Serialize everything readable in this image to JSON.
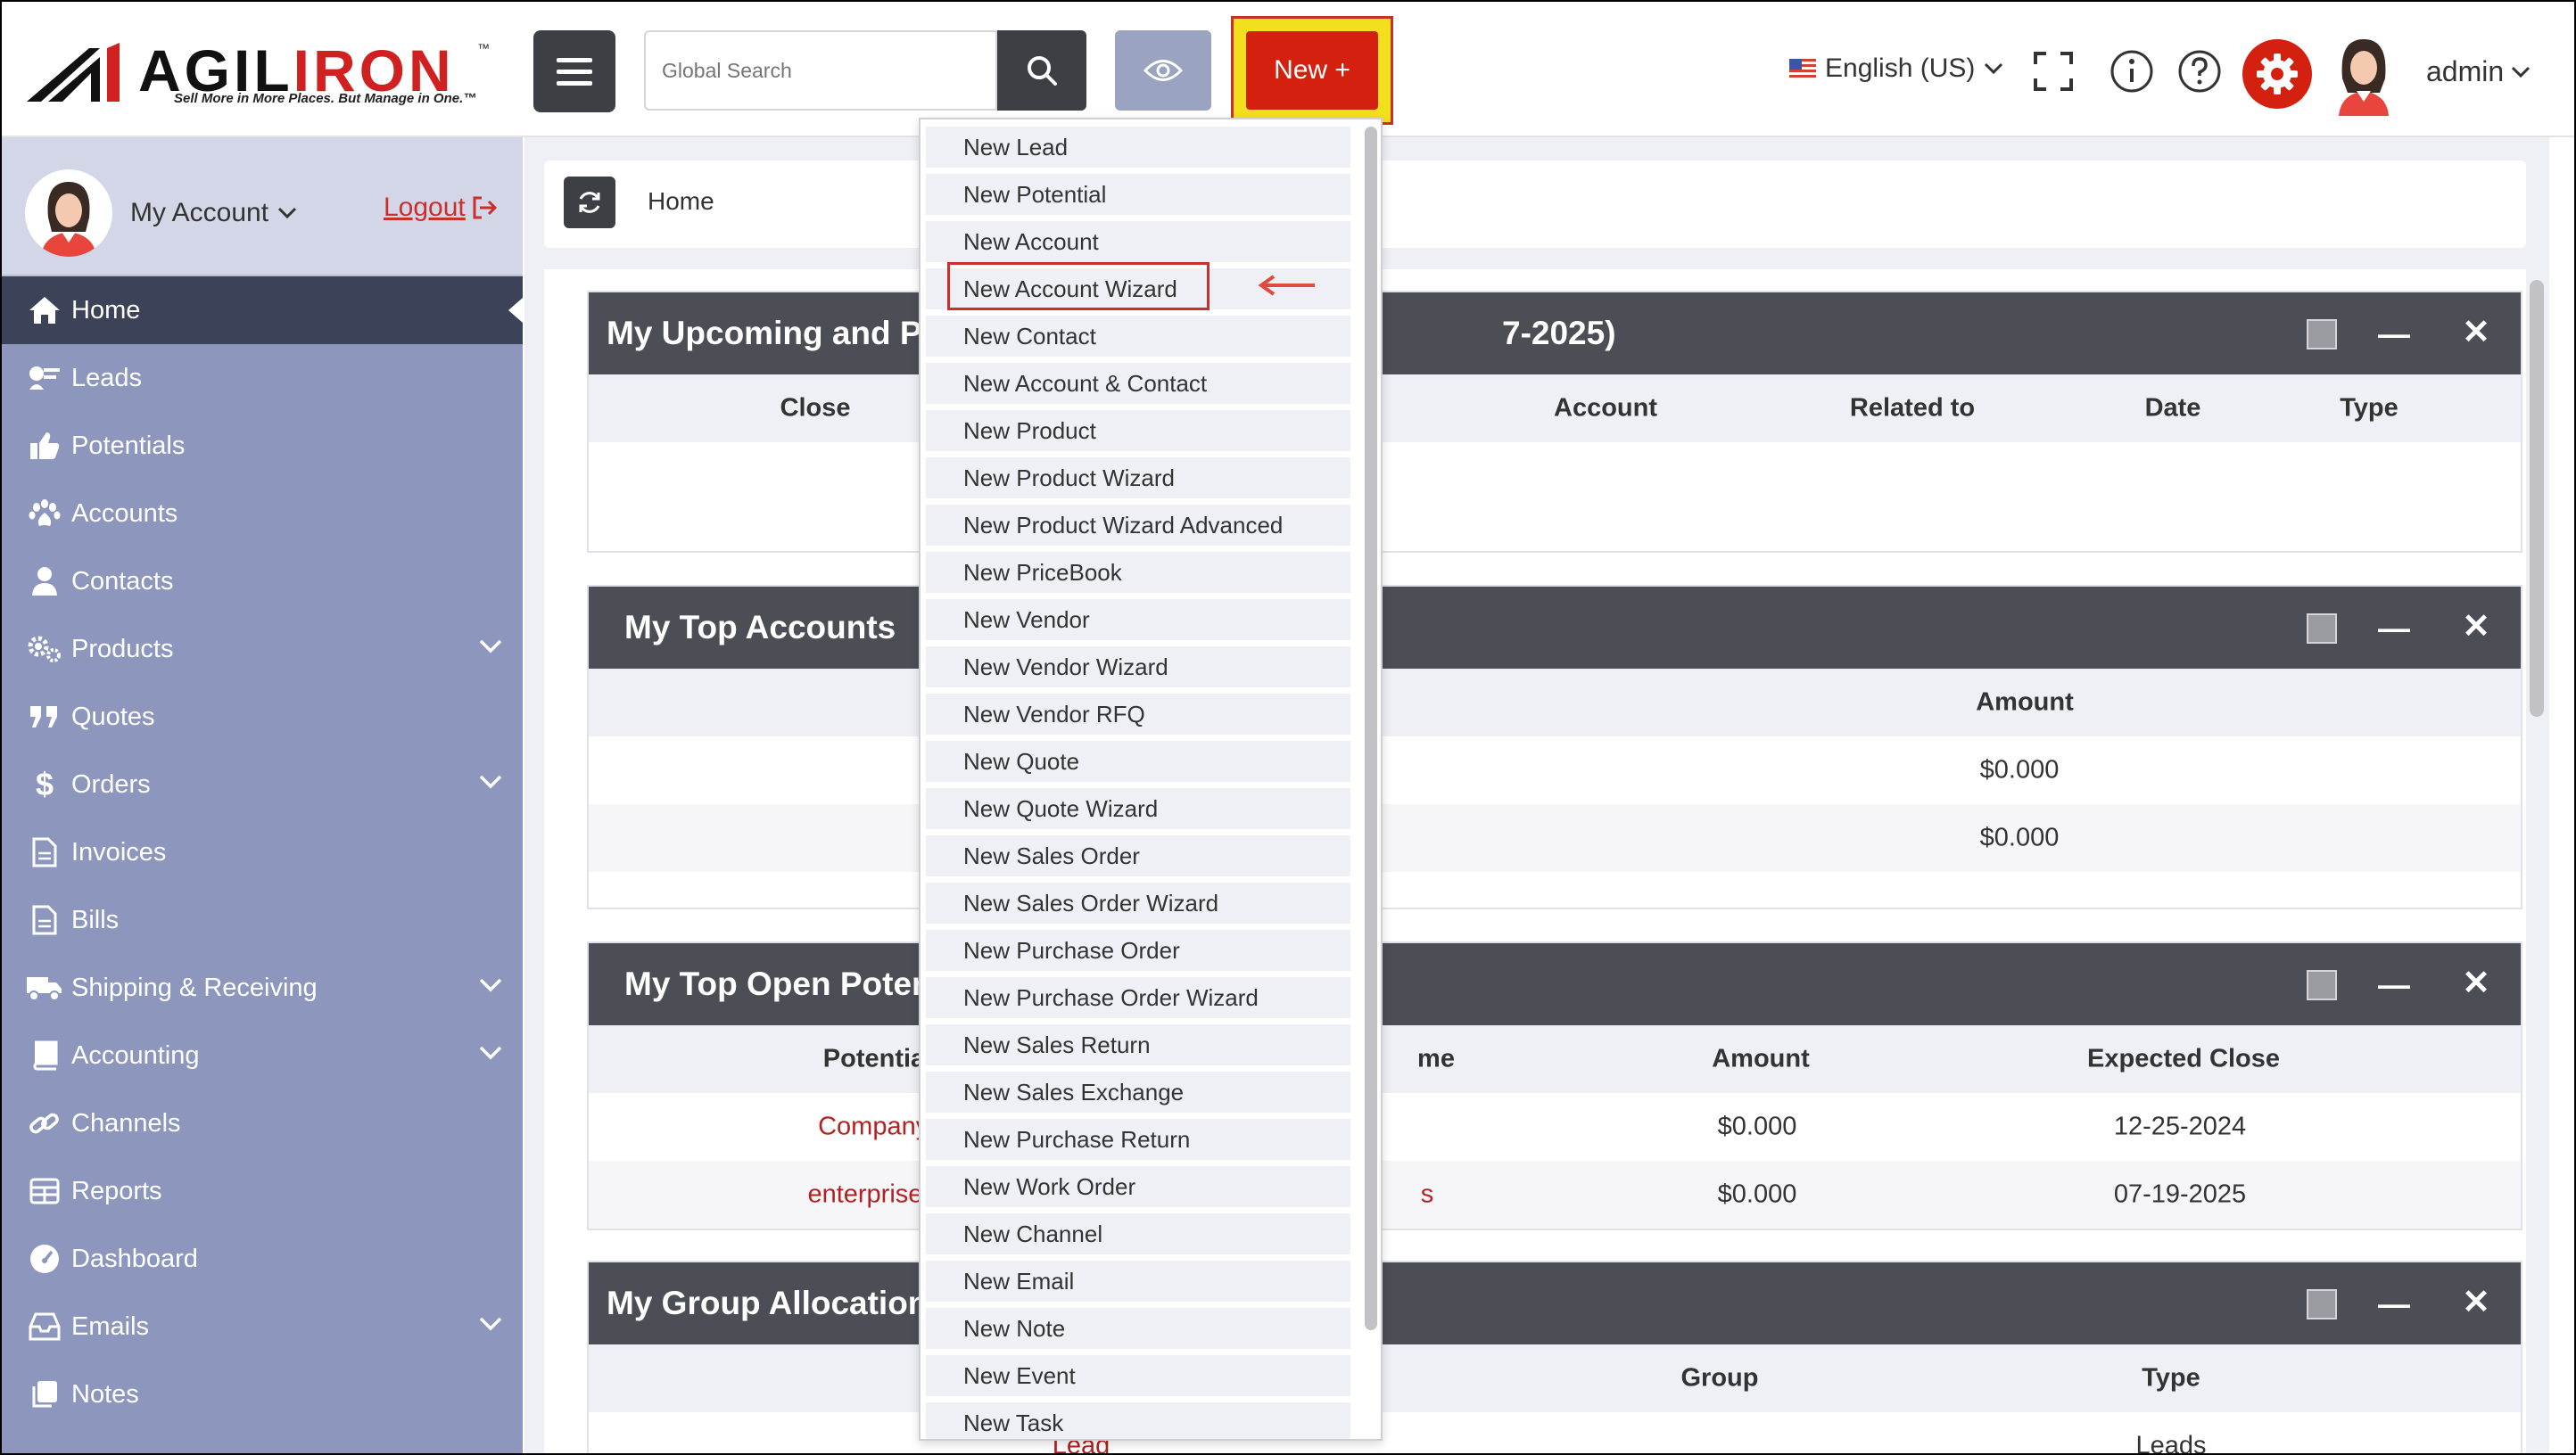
{
  "header": {
    "logo_text_black": "AGIL",
    "logo_text_red": "IRON",
    "logo_tm": "™",
    "logo_tagline": "Sell More in More Places. But Manage in One.™",
    "search_placeholder": "Global Search",
    "new_button_label": "New +",
    "language": "English (US)",
    "user": "admin"
  },
  "sidebar": {
    "my_account": "My Account",
    "logout": "Logout",
    "items": [
      {
        "label": "Home",
        "icon": "home-icon",
        "active": true
      },
      {
        "label": "Leads",
        "icon": "leads-icon"
      },
      {
        "label": "Potentials",
        "icon": "thumbs-up-icon"
      },
      {
        "label": "Accounts",
        "icon": "paw-icon"
      },
      {
        "label": "Contacts",
        "icon": "person-icon"
      },
      {
        "label": "Products",
        "icon": "gears-icon",
        "expandable": true
      },
      {
        "label": "Quotes",
        "icon": "quote-icon"
      },
      {
        "label": "Orders",
        "icon": "dollar-icon",
        "expandable": true
      },
      {
        "label": "Invoices",
        "icon": "document-icon"
      },
      {
        "label": "Bills",
        "icon": "document-icon"
      },
      {
        "label": "Shipping & Receiving",
        "icon": "truck-icon",
        "expandable": true
      },
      {
        "label": "Accounting",
        "icon": "book-icon",
        "expandable": true
      },
      {
        "label": "Channels",
        "icon": "link-icon"
      },
      {
        "label": "Reports",
        "icon": "table-icon"
      },
      {
        "label": "Dashboard",
        "icon": "gauge-icon"
      },
      {
        "label": "Emails",
        "icon": "inbox-icon",
        "expandable": true
      },
      {
        "label": "Notes",
        "icon": "notes-icon"
      }
    ]
  },
  "breadcrumb": {
    "current": "Home"
  },
  "panels": {
    "upcoming": {
      "title_left": "My Upcoming and Per",
      "title_right": "7-2025)",
      "columns": [
        "Close",
        "Account",
        "Related to",
        "Date",
        "Type"
      ]
    },
    "top_accounts": {
      "title": "My Top Accounts",
      "amount_header": "Amount",
      "rows": [
        "$0.000",
        "$0.000"
      ]
    },
    "open_potentials": {
      "title": "My Top Open Potent",
      "columns": [
        "Potential",
        "me",
        "Amount",
        "Expected Close"
      ],
      "rows": [
        {
          "potential": "Company-",
          "name_tail": "",
          "amount": "$0.000",
          "close": "12-25-2024"
        },
        {
          "potential": "enterprises-",
          "name_tail": "s",
          "amount": "$0.000",
          "close": "07-19-2025"
        }
      ]
    },
    "group_allocation": {
      "title": "My Group Allocation",
      "columns": [
        "Group",
        "Type"
      ],
      "row": {
        "left": "Lead",
        "type": "Leads"
      }
    }
  },
  "dropdown": {
    "items": [
      "New Lead",
      "New Potential",
      "New Account",
      "New Account Wizard",
      "New Contact",
      "New Account & Contact",
      "New Product",
      "New Product Wizard",
      "New Product Wizard Advanced",
      "New PriceBook",
      "New Vendor",
      "New Vendor Wizard",
      "New Vendor RFQ",
      "New Quote",
      "New Quote Wizard",
      "New Sales Order",
      "New Sales Order Wizard",
      "New Purchase Order",
      "New Purchase Order Wizard",
      "New Sales Return",
      "New Sales Exchange",
      "New Purchase Return",
      "New Work Order",
      "New Channel",
      "New Email",
      "New Note",
      "New Event",
      "New Task"
    ],
    "highlighted": "New Account Wizard"
  },
  "colors": {
    "brand_red": "#d4200f",
    "highlight_yellow": "#f2e01c",
    "sidebar": "#8d97bd",
    "dark": "#3c3f44"
  }
}
